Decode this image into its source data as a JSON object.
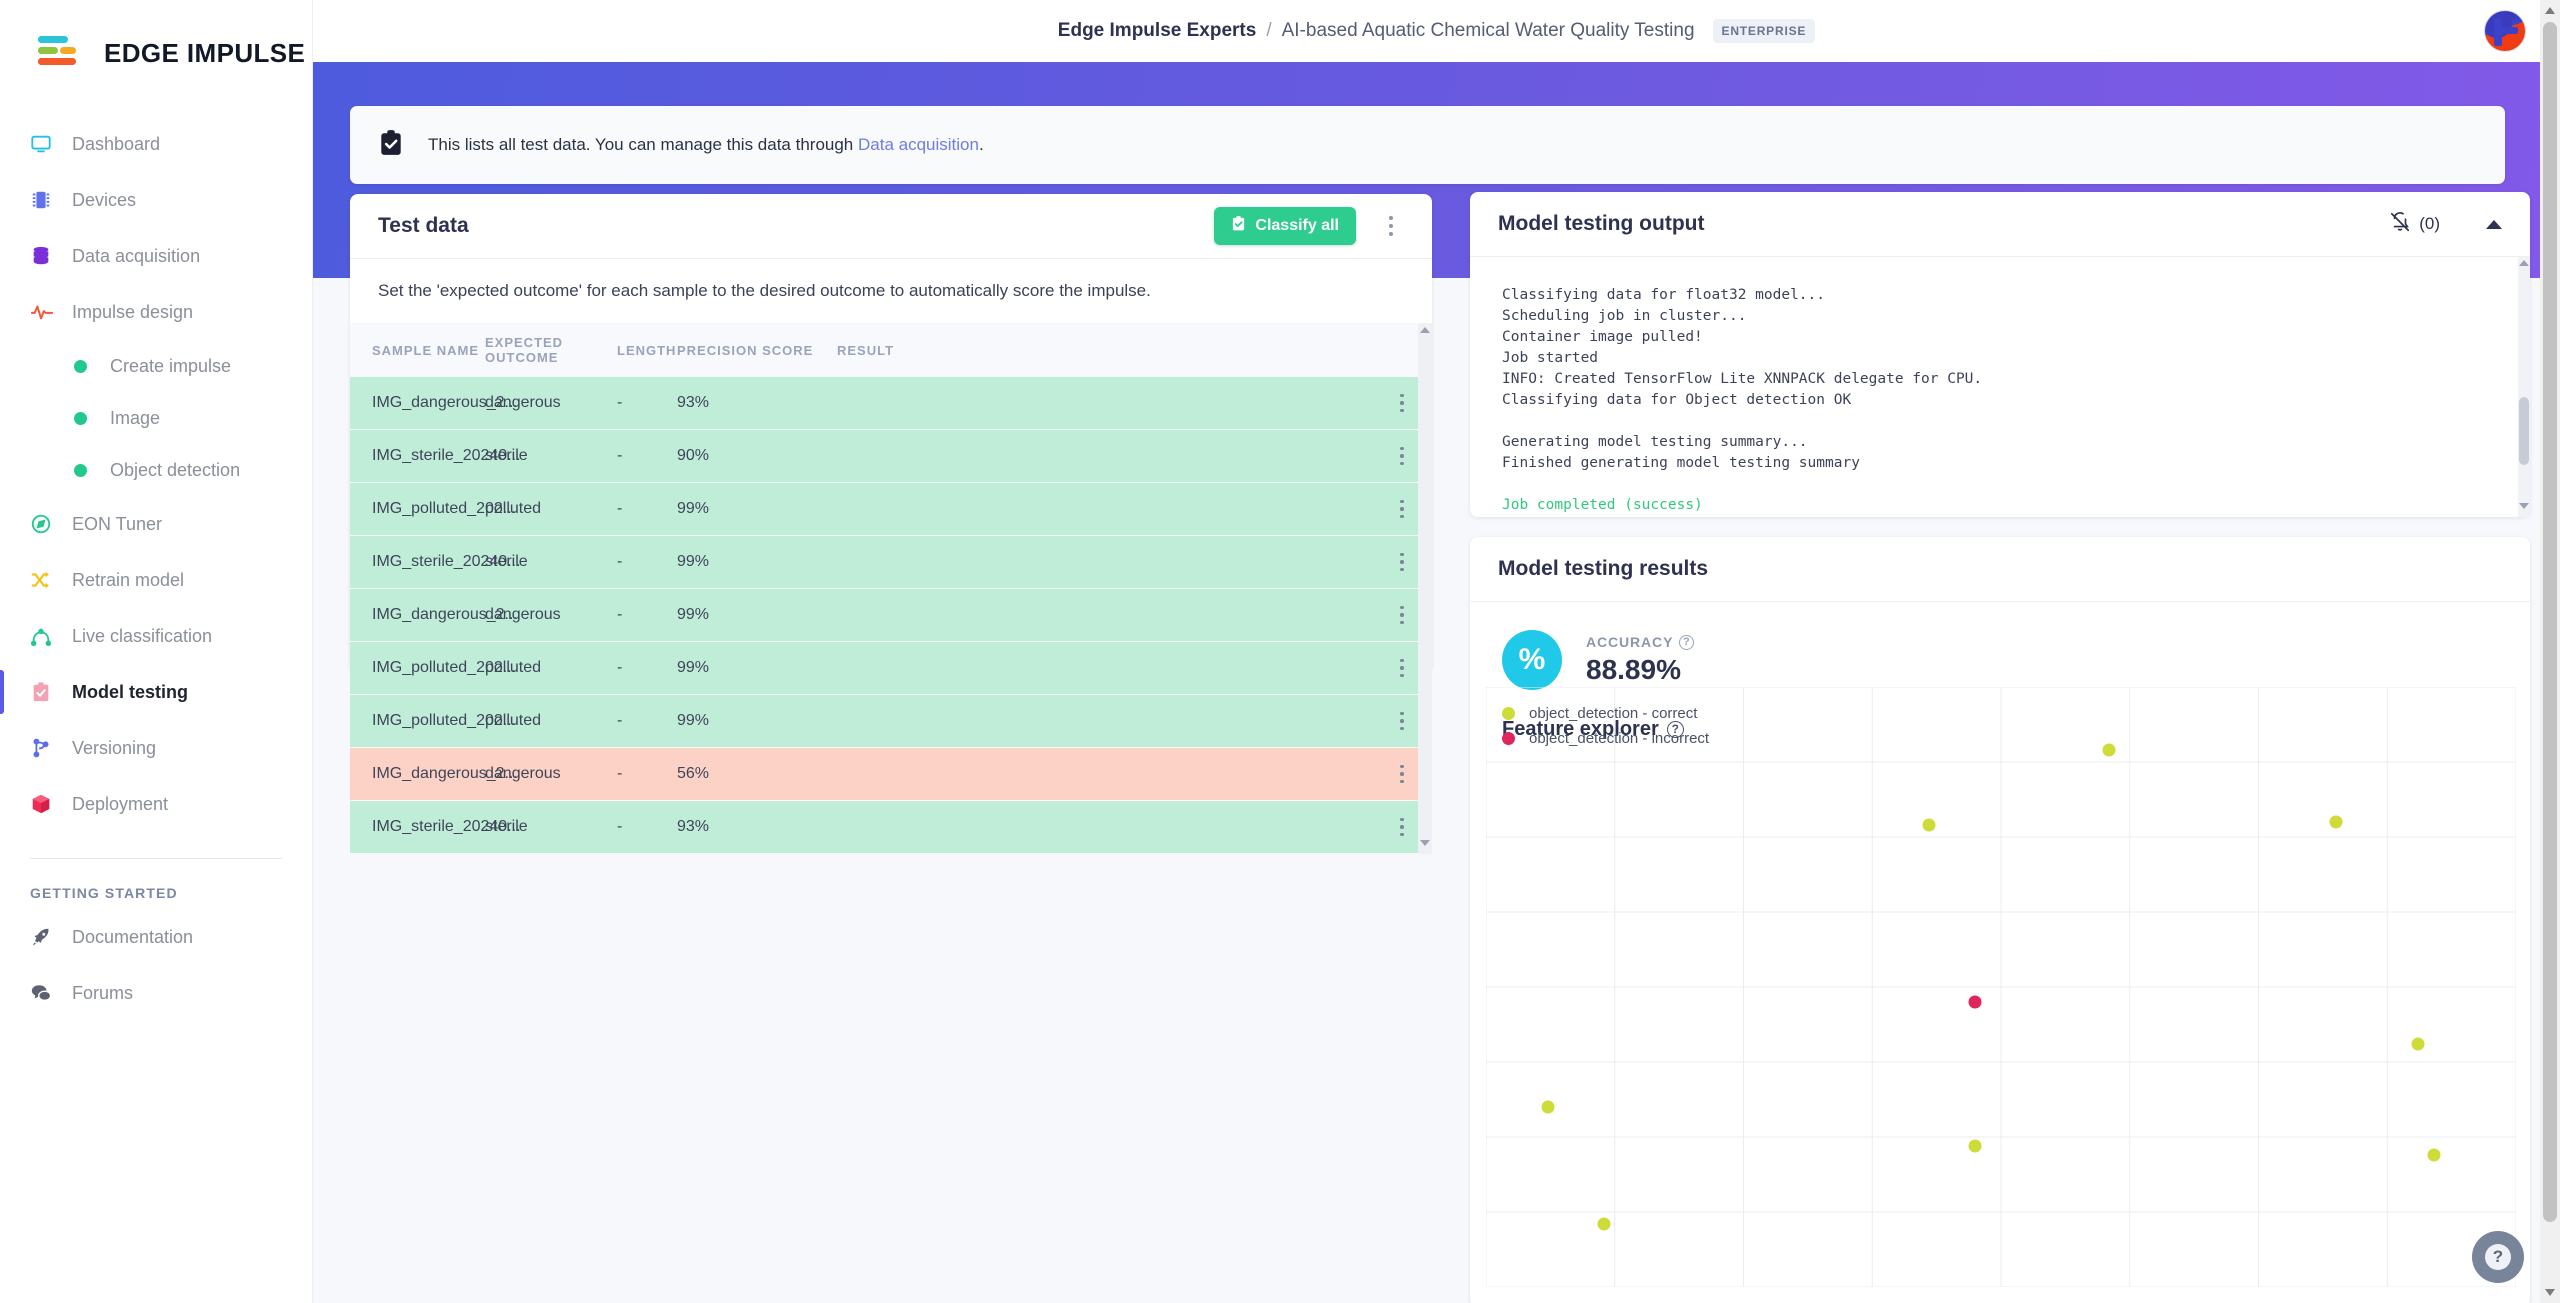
{
  "brand": {
    "name": "EDGE IMPULSE"
  },
  "header": {
    "org": "Edge Impulse Experts",
    "separator": "/",
    "project": "AI-based Aquatic Chemical Water Quality Testing",
    "badge": "ENTERPRISE"
  },
  "sidebar": {
    "items": [
      {
        "label": "Dashboard",
        "icon": "monitor-icon"
      },
      {
        "label": "Devices",
        "icon": "chip-icon"
      },
      {
        "label": "Data acquisition",
        "icon": "database-icon"
      },
      {
        "label": "Impulse design",
        "icon": "pulse-icon"
      },
      {
        "label": "Create impulse",
        "icon": "dot-icon",
        "sub": true
      },
      {
        "label": "Image",
        "icon": "dot-icon",
        "sub": true
      },
      {
        "label": "Object detection",
        "icon": "dot-icon",
        "sub": true
      },
      {
        "label": "EON Tuner",
        "icon": "compass-icon"
      },
      {
        "label": "Retrain model",
        "icon": "shuffle-icon"
      },
      {
        "label": "Live classification",
        "icon": "network-icon"
      },
      {
        "label": "Model testing",
        "icon": "clipboard-check-icon",
        "active": true
      },
      {
        "label": "Versioning",
        "icon": "git-branch-icon"
      },
      {
        "label": "Deployment",
        "icon": "cube-icon"
      }
    ],
    "section_title": "GETTING STARTED",
    "getting_started": [
      {
        "label": "Documentation",
        "icon": "rocket-icon"
      },
      {
        "label": "Forums",
        "icon": "chat-icon"
      }
    ]
  },
  "banner": {
    "icon": "clipboard-check-icon",
    "text_before": "This lists all test data. You can manage this data through ",
    "link": "Data acquisition",
    "text_after": "."
  },
  "test_data": {
    "title": "Test data",
    "classify_button": "Classify all",
    "classify_icon": "clipboard-check-icon",
    "menu_icon": "kebab-menu-icon",
    "subtitle": "Set the 'expected outcome' for each sample to the desired outcome to automatically score the impulse.",
    "columns": [
      "SAMPLE NAME",
      "EXPECTED OUTCOME",
      "LENGTH",
      "PRECISION SCORE",
      "RESULT"
    ],
    "rows": [
      {
        "name": "IMG_dangerous_2...",
        "expected": "dangerous",
        "length": "-",
        "precision": "93%",
        "result": "",
        "status": "ok"
      },
      {
        "name": "IMG_sterile_20240...",
        "expected": "sterile",
        "length": "-",
        "precision": "90%",
        "result": "",
        "status": "ok"
      },
      {
        "name": "IMG_polluted_202...",
        "expected": "polluted",
        "length": "-",
        "precision": "99%",
        "result": "",
        "status": "ok"
      },
      {
        "name": "IMG_sterile_20240...",
        "expected": "sterile",
        "length": "-",
        "precision": "99%",
        "result": "",
        "status": "ok"
      },
      {
        "name": "IMG_dangerous_2...",
        "expected": "dangerous",
        "length": "-",
        "precision": "99%",
        "result": "",
        "status": "ok"
      },
      {
        "name": "IMG_polluted_202...",
        "expected": "polluted",
        "length": "-",
        "precision": "99%",
        "result": "",
        "status": "ok"
      },
      {
        "name": "IMG_polluted_202...",
        "expected": "polluted",
        "length": "-",
        "precision": "99%",
        "result": "",
        "status": "ok"
      },
      {
        "name": "IMG_dangerous_2...",
        "expected": "dangerous",
        "length": "-",
        "precision": "56%",
        "result": "",
        "status": "bad"
      },
      {
        "name": "IMG_sterile_20240...",
        "expected": "sterile",
        "length": "-",
        "precision": "93%",
        "result": "",
        "status": "ok"
      }
    ]
  },
  "output_panel": {
    "title": "Model testing output",
    "bell_icon": "bell-off-icon",
    "notification_count": "(0)",
    "collapse_icon": "caret-up-icon",
    "log_lines": [
      {
        "text": "Classifying data for float32 model...",
        "type": "normal"
      },
      {
        "text": "Scheduling job in cluster...",
        "type": "normal"
      },
      {
        "text": "Container image pulled!",
        "type": "normal"
      },
      {
        "text": "Job started",
        "type": "normal"
      },
      {
        "text": "INFO: Created TensorFlow Lite XNNPACK delegate for CPU.",
        "type": "normal"
      },
      {
        "text": "Classifying data for Object detection OK",
        "type": "normal"
      },
      {
        "text": "",
        "type": "blank"
      },
      {
        "text": "Generating model testing summary...",
        "type": "normal"
      },
      {
        "text": "Finished generating model testing summary",
        "type": "normal"
      },
      {
        "text": "",
        "type": "blank"
      },
      {
        "text": "Job completed (success)",
        "type": "success"
      }
    ]
  },
  "results_panel": {
    "title": "Model testing results",
    "accuracy_label": "ACCURACY",
    "accuracy_value": "88.89%",
    "accuracy_icon": "percent-icon",
    "feature_explorer_title": "Feature explorer",
    "help_icon": "question-icon"
  },
  "chart_data": {
    "type": "scatter",
    "title": "Feature explorer",
    "xlabel": "",
    "ylabel": "",
    "grid": true,
    "legend_position": "top-left",
    "legend": [
      {
        "name": "object_detection - correct",
        "color": "#cddc39"
      },
      {
        "name": "object_detection - incorrect",
        "color": "#e0245e"
      }
    ],
    "xlim": [
      0,
      100
    ],
    "ylim": [
      0,
      100
    ],
    "series": [
      {
        "name": "object_detection - correct",
        "color": "#cddc39",
        "points": [
          {
            "x": 60.5,
            "y": 89.5
          },
          {
            "x": 43.0,
            "y": 77.0
          },
          {
            "x": 82.5,
            "y": 77.5
          },
          {
            "x": 90.5,
            "y": 40.5
          },
          {
            "x": 6.0,
            "y": 30.0
          },
          {
            "x": 47.5,
            "y": 23.5
          },
          {
            "x": 92.0,
            "y": 22.0
          },
          {
            "x": 11.5,
            "y": 10.5
          }
        ]
      },
      {
        "name": "object_detection - incorrect",
        "color": "#e0245e",
        "points": [
          {
            "x": 47.5,
            "y": 47.5
          }
        ]
      }
    ]
  },
  "help_fab": {
    "icon": "question-icon",
    "label": "?"
  }
}
